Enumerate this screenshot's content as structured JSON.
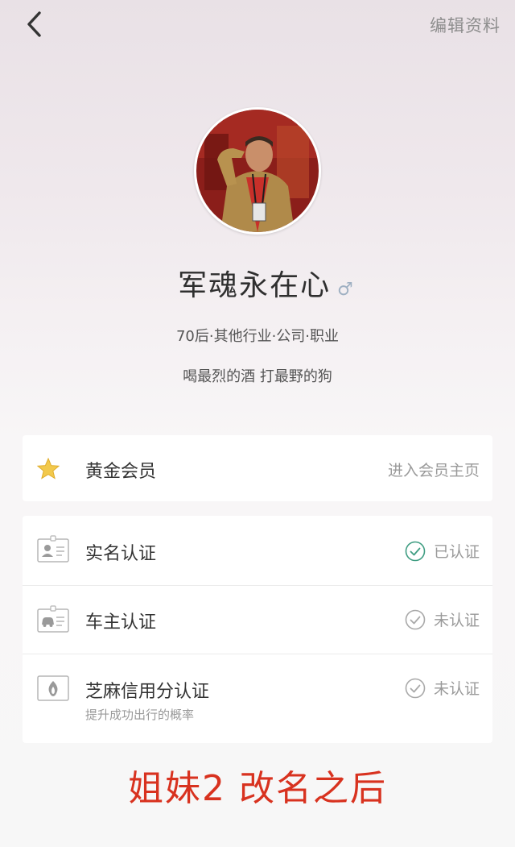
{
  "header": {
    "back_icon": "chevron-left-icon",
    "edit_label": "编辑资料"
  },
  "profile": {
    "avatar_icon": "avatar-photo",
    "name": "军魂永在心",
    "gender_symbol": "♂",
    "gender_color": "#9fb0c2",
    "info": "70后·其他行业·公司·职业",
    "signature": "喝最烈的酒 打最野的狗"
  },
  "vip": {
    "icon": "star-icon",
    "label": "黄金会员",
    "action": "进入会员主页"
  },
  "verifications": [
    {
      "icon": "id-card-icon",
      "label": "实名认证",
      "status": "已认证",
      "verified": true
    },
    {
      "icon": "car-card-icon",
      "label": "车主认证",
      "status": "未认证",
      "verified": false
    },
    {
      "icon": "sesame-credit-icon",
      "label": "芝麻信用分认证",
      "sub": "提升成功出行的概率",
      "status": "未认证",
      "verified": false
    }
  ],
  "overlay_caption": "姐妹2 改名之后",
  "colors": {
    "verified": "#3f9d82",
    "unverified": "#9a9a9a",
    "star": "#f2c94c",
    "caption": "#d8321f"
  }
}
